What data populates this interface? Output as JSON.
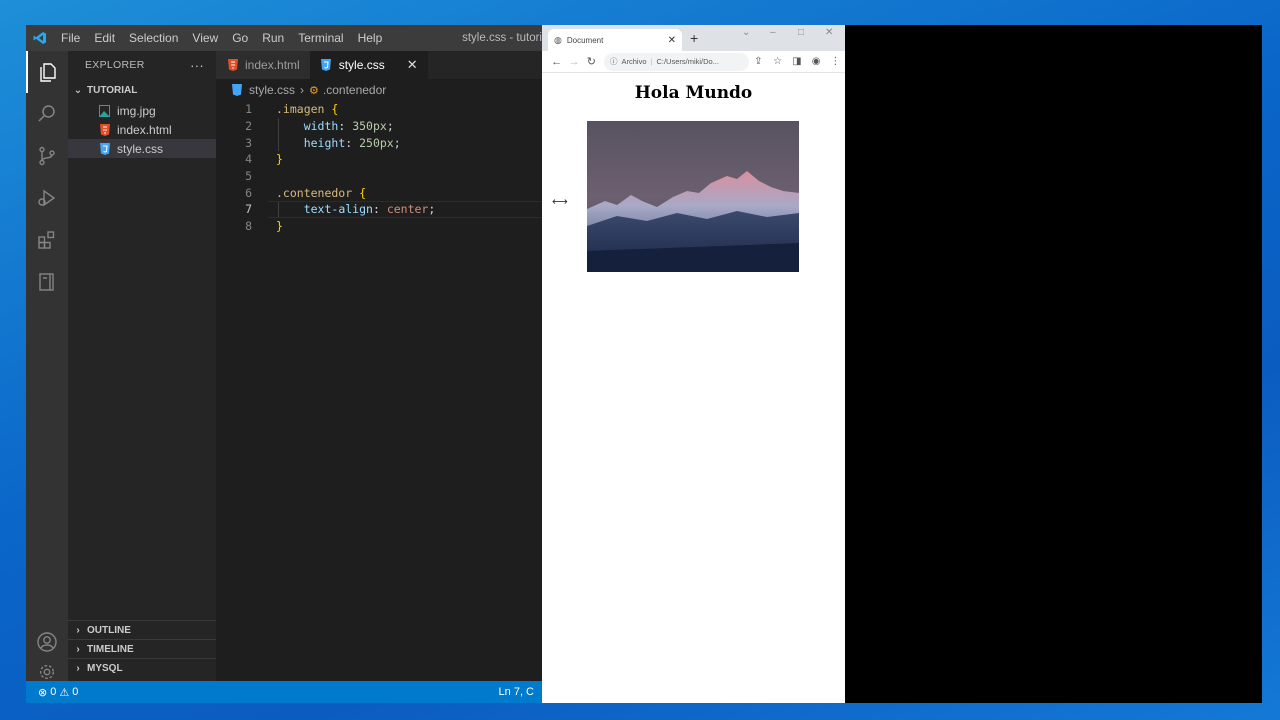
{
  "vscode": {
    "menu": [
      "File",
      "Edit",
      "Selection",
      "View",
      "Go",
      "Run",
      "Terminal",
      "Help"
    ],
    "window_title": "style.css - tutori",
    "sidebar": {
      "header": "EXPLORER",
      "more": "···",
      "folder": "TUTORIAL",
      "files": [
        {
          "name": "img.jpg",
          "icon": "image-file-icon"
        },
        {
          "name": "index.html",
          "icon": "html-file-icon"
        },
        {
          "name": "style.css",
          "icon": "css-file-icon",
          "selected": true
        }
      ],
      "bottom_sections": [
        "OUTLINE",
        "TIMELINE",
        "MYSQL"
      ]
    },
    "tabs": [
      {
        "label": "index.html",
        "active": false
      },
      {
        "label": "style.css",
        "active": true,
        "close": "✕"
      }
    ],
    "breadcrumb": {
      "file": "style.css",
      "symbol": ".contenedor"
    },
    "code_lines": [
      "1",
      "2",
      "3",
      "4",
      "5",
      "6",
      "7",
      "8"
    ],
    "code": {
      "l1_sel": ".imagen",
      "l1_brace": "{",
      "l2_prop": "width",
      "l2_val": "350px",
      "l3_prop": "height",
      "l3_val": "250px",
      "l4_brace": "}",
      "l6_sel": ".contenedor",
      "l6_brace": "{",
      "l7_prop": "text-align",
      "l7_val": "center",
      "l8_brace": "}"
    },
    "status": {
      "errors": "0",
      "warnings": "0",
      "position": "Ln 7, C"
    },
    "colors": {
      "statusbar": "#007acc",
      "activitybar": "#333333",
      "editor": "#1e1e1e"
    }
  },
  "browser": {
    "tab_title": "Document",
    "tab_close": "✕",
    "new_tab": "+",
    "address_label": "Archivo",
    "address": "C:/Users/miki/Do...",
    "page_heading": "Hola Mundo"
  }
}
